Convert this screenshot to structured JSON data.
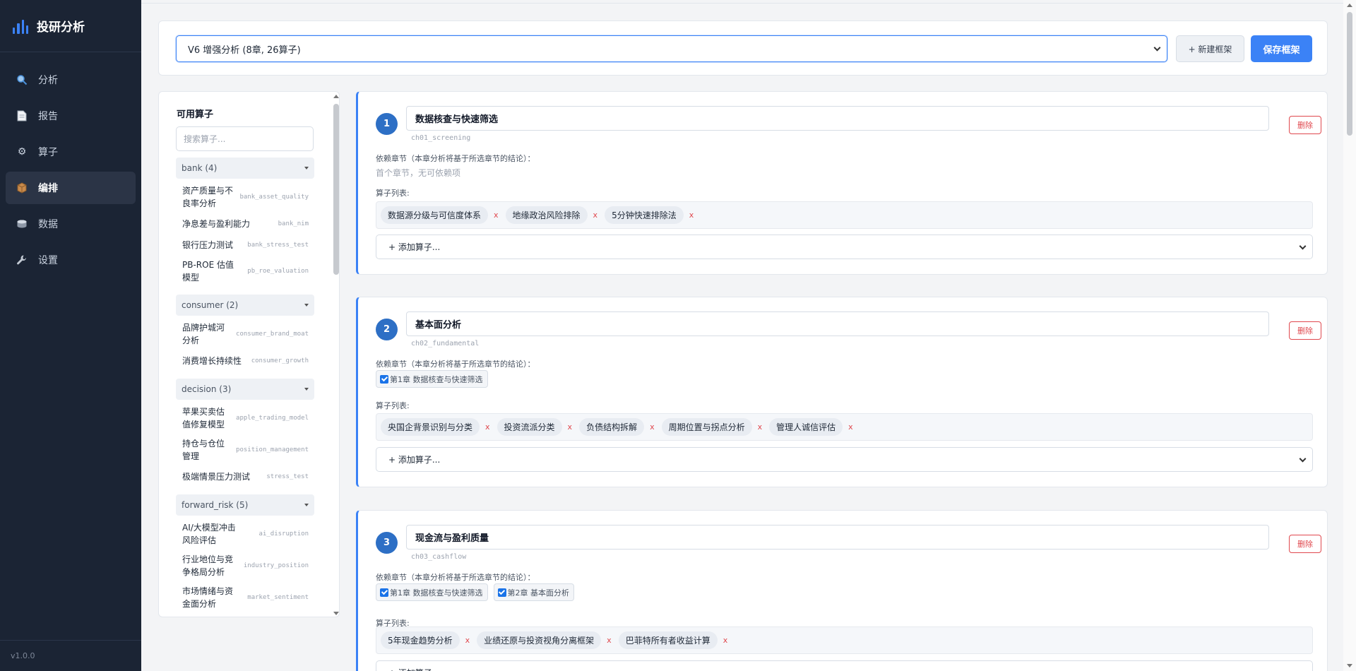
{
  "app": {
    "title": "投研分析",
    "version": "v1.0.0"
  },
  "nav": [
    {
      "label": "分析",
      "icon": "magnifier-icon",
      "active": false
    },
    {
      "label": "报告",
      "icon": "document-icon",
      "active": false
    },
    {
      "label": "算子",
      "icon": "gear-icon",
      "active": false
    },
    {
      "label": "编排",
      "icon": "package-icon",
      "active": true
    },
    {
      "label": "数据",
      "icon": "database-icon",
      "active": false
    },
    {
      "label": "设置",
      "icon": "wrench-icon",
      "active": false
    }
  ],
  "toolbar": {
    "framework_selected": "V6 增强分析 (8章, 26算子)",
    "new_label": "+ 新建框架",
    "save_label": "保存框架"
  },
  "operators_panel": {
    "title": "可用算子",
    "search_placeholder": "搜索算子...",
    "groups": [
      {
        "name": "bank (4)",
        "items": [
          {
            "name": "资产质量与不良率分析",
            "code": "bank_asset_quality"
          },
          {
            "name": "净息差与盈利能力",
            "code": "bank_nim"
          },
          {
            "name": "银行压力测试",
            "code": "bank_stress_test"
          },
          {
            "name": "PB-ROE 估值模型",
            "code": "pb_roe_valuation"
          }
        ]
      },
      {
        "name": "consumer (2)",
        "items": [
          {
            "name": "品牌护城河分析",
            "code": "consumer_brand_moat"
          },
          {
            "name": "消费增长持续性",
            "code": "consumer_growth"
          }
        ]
      },
      {
        "name": "decision (3)",
        "items": [
          {
            "name": "苹果买卖估值修复模型",
            "code": "apple_trading_model"
          },
          {
            "name": "持仓与仓位管理",
            "code": "position_management"
          },
          {
            "name": "极端情景压力测试",
            "code": "stress_test"
          }
        ]
      },
      {
        "name": "forward_risk (5)",
        "items": [
          {
            "name": "AI/大模型冲击风险评估",
            "code": "ai_disruption"
          },
          {
            "name": "行业地位与竞争格局分析",
            "code": "industry_position"
          },
          {
            "name": "市场情绪与资金面分析",
            "code": "market_sentiment"
          }
        ]
      }
    ]
  },
  "labels": {
    "depends": "依赖章节（本章分析将基于所选章节的结论）：",
    "operators": "算子列表:",
    "add_operator": "+ 添加算子...",
    "delete": "删除",
    "no_deps": "首个章节，无可依赖项",
    "remove": "x"
  },
  "chapters": [
    {
      "number": "1",
      "title": "数据核查与快速筛选",
      "code": "ch01_screening",
      "depends": [],
      "operators": [
        "数据源分级与可信度体系",
        "地缘政治风险排除",
        "5分钟快速排除法"
      ]
    },
    {
      "number": "2",
      "title": "基本面分析",
      "code": "ch02_fundamental",
      "depends": [
        "第1章 数据核查与快速筛选"
      ],
      "operators": [
        "央国企背景识别与分类",
        "投资流派分类",
        "负债结构拆解",
        "周期位置与拐点分析",
        "管理人诚信评估"
      ]
    },
    {
      "number": "3",
      "title": "现金流与盈利质量",
      "code": "ch03_cashflow",
      "depends": [
        "第1章 数据核查与快速筛选",
        "第2章 基本面分析"
      ],
      "operators": [
        "5年现金趋势分析",
        "业绩还原与投资视角分离框架",
        "巴菲特所有者收益计算"
      ]
    }
  ],
  "colors": {
    "accent": "#3b82f6",
    "sidebar_bg": "#1b2434",
    "danger": "#e0484e"
  }
}
